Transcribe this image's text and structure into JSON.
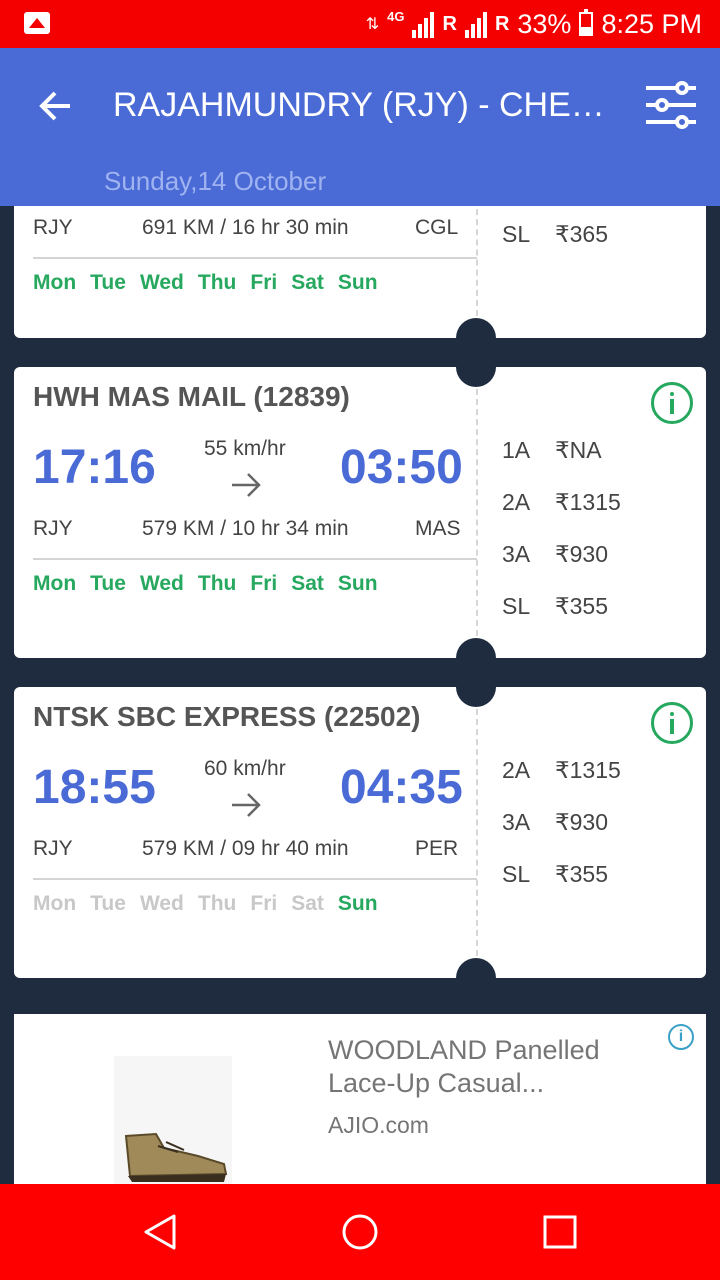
{
  "status_bar": {
    "network": "4G",
    "roaming1": "R",
    "roaming2": "R",
    "battery": "33%",
    "time": "8:25 PM"
  },
  "header": {
    "title": "RAJAHMUNDRY (RJY) - CHEN...",
    "date": "Sunday,14 October"
  },
  "partial_card": {
    "from": "RJY",
    "distance_duration": "691 KM / 16 hr 30 min",
    "to": "CGL",
    "days": [
      {
        "label": "Mon",
        "active": true
      },
      {
        "label": "Tue",
        "active": true
      },
      {
        "label": "Wed",
        "active": true
      },
      {
        "label": "Thu",
        "active": true
      },
      {
        "label": "Fri",
        "active": true
      },
      {
        "label": "Sat",
        "active": true
      },
      {
        "label": "Sun",
        "active": true
      }
    ],
    "fares": [
      {
        "class": "SL",
        "price": "₹365"
      }
    ]
  },
  "trains": [
    {
      "name": "HWH MAS MAIL (12839)",
      "dep_time": "17:16",
      "arr_time": "03:50",
      "speed": "55 km/hr",
      "from": "RJY",
      "distance_duration": "579 KM / 10 hr 34 min",
      "to": "MAS",
      "days": [
        {
          "label": "Mon",
          "active": true
        },
        {
          "label": "Tue",
          "active": true
        },
        {
          "label": "Wed",
          "active": true
        },
        {
          "label": "Thu",
          "active": true
        },
        {
          "label": "Fri",
          "active": true
        },
        {
          "label": "Sat",
          "active": true
        },
        {
          "label": "Sun",
          "active": true
        }
      ],
      "fares": [
        {
          "class": "1A",
          "price": "₹NA"
        },
        {
          "class": "2A",
          "price": "₹1315"
        },
        {
          "class": "3A",
          "price": "₹930"
        },
        {
          "class": "SL",
          "price": "₹355"
        }
      ]
    },
    {
      "name": "NTSK SBC EXPRESS (22502)",
      "dep_time": "18:55",
      "arr_time": "04:35",
      "speed": "60 km/hr",
      "from": "RJY",
      "distance_duration": "579 KM / 09 hr 40 min",
      "to": "PER",
      "days": [
        {
          "label": "Mon",
          "active": false
        },
        {
          "label": "Tue",
          "active": false
        },
        {
          "label": "Wed",
          "active": false
        },
        {
          "label": "Thu",
          "active": false
        },
        {
          "label": "Fri",
          "active": false
        },
        {
          "label": "Sat",
          "active": false
        },
        {
          "label": "Sun",
          "active": true
        }
      ],
      "fares": [
        {
          "class": "2A",
          "price": "₹1315"
        },
        {
          "class": "3A",
          "price": "₹930"
        },
        {
          "class": "SL",
          "price": "₹355"
        }
      ]
    }
  ],
  "ad": {
    "title": "WOODLAND Panelled Lace-Up Casual...",
    "source": "AJIO.com",
    "info_glyph": "i"
  },
  "colors": {
    "status_bar": "#f50000",
    "app_bar": "#4a6ad6",
    "time_blue": "#4a6ad6",
    "day_green": "#27a85f",
    "day_off": "#c8c8c8",
    "background": "#1f2c3f"
  }
}
